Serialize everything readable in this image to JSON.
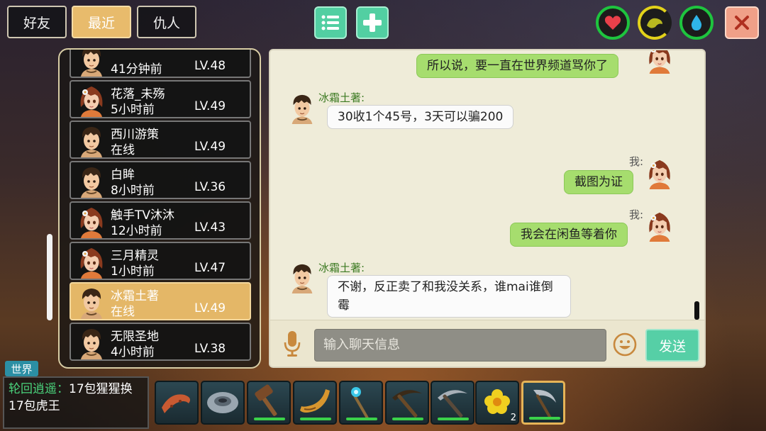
{
  "tabs": [
    {
      "label": "好友",
      "active": false
    },
    {
      "label": "最近",
      "active": true
    },
    {
      "label": "仇人",
      "active": false
    }
  ],
  "toolbar": {
    "list_icon": "list-icon",
    "add_icon": "plus-icon"
  },
  "status_icons": [
    {
      "icon": "heart-icon",
      "color": "#e8404a",
      "ring": "#1ec43e"
    },
    {
      "icon": "food-icon",
      "color": "#c0c020",
      "ring": "#e2d21a"
    },
    {
      "icon": "water-drop-icon",
      "color": "#2fb4e8",
      "ring": "#1ec43e"
    }
  ],
  "close_icon": "close-icon",
  "friends": [
    {
      "name": "",
      "status": "41分钟前",
      "level": "LV.48",
      "avatar": "boy",
      "selected": false
    },
    {
      "name": "花落_未殇",
      "status": "5小时前",
      "level": "LV.49",
      "avatar": "girl",
      "selected": false
    },
    {
      "name": "西川游策",
      "status": "在线",
      "level": "LV.49",
      "avatar": "boy",
      "selected": false
    },
    {
      "name": "白眸",
      "status": "8小时前",
      "level": "LV.36",
      "avatar": "boy",
      "selected": false
    },
    {
      "name": "触手TV沐沐",
      "status": "12小时前",
      "level": "LV.43",
      "avatar": "girl",
      "selected": false
    },
    {
      "name": "三月精灵",
      "status": "1小时前",
      "level": "LV.47",
      "avatar": "girl",
      "selected": false
    },
    {
      "name": "冰霜土著",
      "status": "在线",
      "level": "LV.49",
      "avatar": "boy",
      "selected": true
    },
    {
      "name": "无限圣地",
      "status": "4小时前",
      "level": "LV.38",
      "avatar": "boy",
      "selected": false
    }
  ],
  "messages": [
    {
      "from": "me",
      "sender": "",
      "text": "所以说，要一直在世界频道骂你了"
    },
    {
      "from": "other",
      "sender": "冰霜土著:",
      "text": "30收1个45号，3天可以骗200"
    },
    {
      "from": "me",
      "sender": "我:",
      "text": "截图为证"
    },
    {
      "from": "me",
      "sender": "我:",
      "text": "我会在闲鱼等着你"
    },
    {
      "from": "other",
      "sender": "冰霜土著:",
      "text": "不谢，反正卖了和我没关系，谁mai谁倒霉"
    }
  ],
  "chat_input": {
    "placeholder": "输入聊天信息",
    "send_label": "发送",
    "mic_icon": "microphone-icon",
    "emoji_icon": "emoji-icon"
  },
  "world_chat": {
    "tag": "世界",
    "speaker": "轮回逍遥：",
    "text": "17包猩猩换17包虎王"
  },
  "hotbar": [
    {
      "icon": "boomerang-icon",
      "count": "",
      "durability": false,
      "selected": false
    },
    {
      "icon": "stone-disc-icon",
      "count": "",
      "durability": false,
      "selected": false
    },
    {
      "icon": "hammer-icon",
      "count": "",
      "durability": true,
      "selected": false
    },
    {
      "icon": "horn-icon",
      "count": "",
      "durability": true,
      "selected": false
    },
    {
      "icon": "magic-staff-icon",
      "count": "",
      "durability": true,
      "selected": false
    },
    {
      "icon": "pickaxe-icon",
      "count": "",
      "durability": true,
      "selected": false
    },
    {
      "icon": "iron-pickaxe-icon",
      "count": "",
      "durability": true,
      "selected": false
    },
    {
      "icon": "flower-icon",
      "count": "2",
      "durability": false,
      "selected": false
    },
    {
      "icon": "scythe-icon",
      "count": "",
      "durability": true,
      "selected": true
    }
  ]
}
